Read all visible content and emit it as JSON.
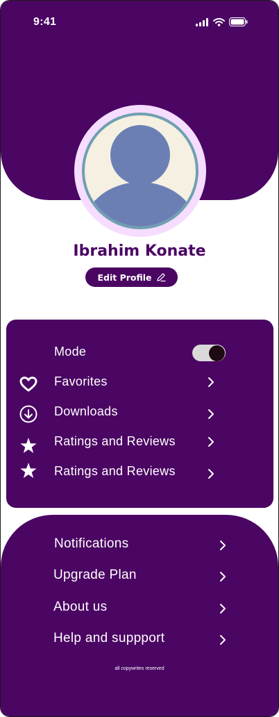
{
  "status_bar": {
    "time": "9:41"
  },
  "profile": {
    "name": "Ibrahim Konate",
    "edit_label": "Edit Profile"
  },
  "settings_card": {
    "mode_label": "Mode",
    "mode_on": true,
    "items": [
      {
        "label": "Favorites",
        "icon": "heart-icon"
      },
      {
        "label": "Downloads",
        "icon": "download-icon"
      },
      {
        "label": "Ratings and Reviews",
        "icon": "star-icon"
      },
      {
        "label": "Ratings and Reviews",
        "icon": "star-icon"
      }
    ]
  },
  "bottom_menu": {
    "items": [
      {
        "label": "Notifications"
      },
      {
        "label": "Upgrade Plan"
      },
      {
        "label": "About us"
      },
      {
        "label": "Help and suppport"
      }
    ],
    "footer": "all copywrites reserved"
  },
  "colors": {
    "primary": "#4b0563",
    "avatar_ring": "#f6dcff",
    "avatar_fill": "#6b7fb5",
    "avatar_bg": "#f5f0e1",
    "toggle_knob": "#1e0a12"
  }
}
